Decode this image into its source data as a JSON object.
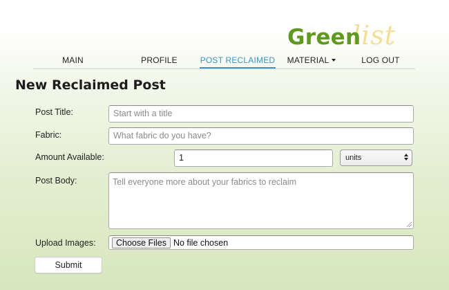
{
  "logo": {
    "text_main": "Green",
    "text_accent": "list"
  },
  "nav": {
    "items": [
      {
        "label": "MAIN"
      },
      {
        "label": "PROFILE"
      },
      {
        "label": "POST RECLAIMED"
      },
      {
        "label": "MATERIAL"
      },
      {
        "label": "LOG OUT"
      }
    ],
    "active": "POST RECLAIMED"
  },
  "page": {
    "title": "New Reclaimed Post"
  },
  "form": {
    "post_title": {
      "label": "Post Title:",
      "value": "",
      "placeholder": "Start with a title"
    },
    "fabric": {
      "label": "Fabric:",
      "value": "",
      "placeholder": "What fabric do you have?"
    },
    "amount": {
      "label": "Amount Available:",
      "value": "1",
      "unit_selected": "units"
    },
    "post_body": {
      "label": "Post Body:",
      "value": "",
      "placeholder": "Tell everyone more about your fabrics to reclaim"
    },
    "upload": {
      "label": "Upload Images:",
      "button_label": "Choose Files",
      "status": "No file chosen"
    },
    "submit_label": "Submit"
  },
  "colors": {
    "brand_green": "#5e9a1f",
    "logo_accent": "#f3df96",
    "nav_active": "#3a94c4"
  }
}
